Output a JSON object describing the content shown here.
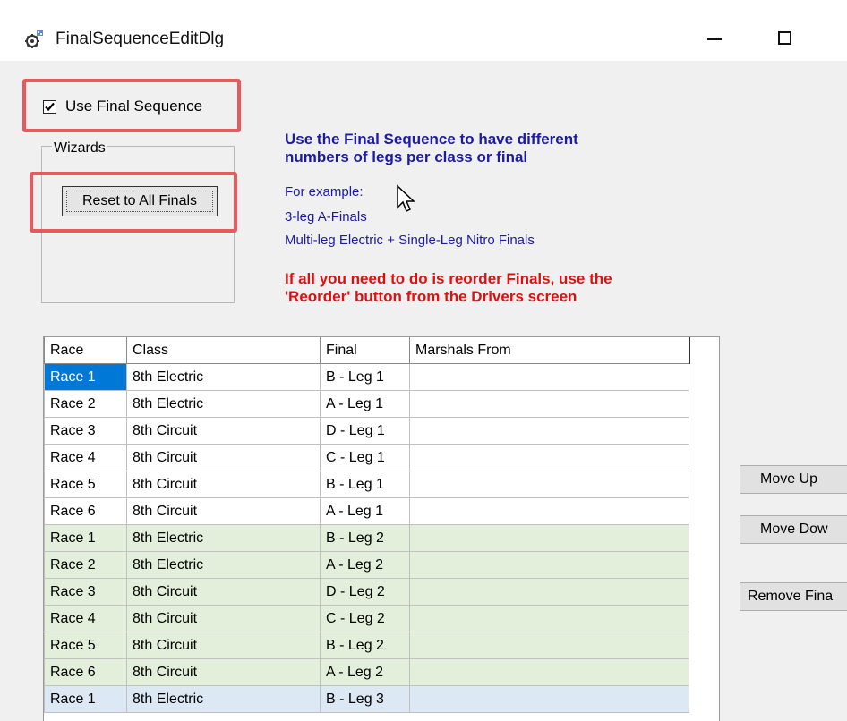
{
  "window": {
    "title": "FinalSequenceEditDlg"
  },
  "use_final_sequence": {
    "label": "Use Final Sequence",
    "checked": true
  },
  "wizards": {
    "legend": "Wizards",
    "reset_label": "Reset to All Finals"
  },
  "info": {
    "heading_line1": "Use the Final Sequence to have different",
    "heading_line2": "numbers of legs per class or final",
    "example_intro": "For example:",
    "example_1": "3-leg A-Finals",
    "example_2": "Multi-leg Electric + Single-Leg Nitro Finals",
    "warning_line1": "If all you need to do is reorder Finals, use the",
    "warning_line2": "'Reorder' button from the Drivers screen"
  },
  "grid": {
    "columns": [
      "Race",
      "Class",
      "Final",
      "Marshals From"
    ],
    "rows": [
      {
        "race": "Race 1",
        "class": "8th Electric",
        "final": "B - Leg 1",
        "marshals": ""
      },
      {
        "race": "Race 2",
        "class": "8th Electric",
        "final": "A - Leg 1",
        "marshals": ""
      },
      {
        "race": "Race 3",
        "class": "8th Circuit",
        "final": "D - Leg 1",
        "marshals": ""
      },
      {
        "race": "Race 4",
        "class": "8th Circuit",
        "final": "C - Leg 1",
        "marshals": ""
      },
      {
        "race": "Race 5",
        "class": "8th Circuit",
        "final": "B - Leg 1",
        "marshals": ""
      },
      {
        "race": "Race 6",
        "class": "8th Circuit",
        "final": "A - Leg 1",
        "marshals": ""
      },
      {
        "race": "Race 1",
        "class": "8th Electric",
        "final": "B - Leg 2",
        "marshals": ""
      },
      {
        "race": "Race 2",
        "class": "8th Electric",
        "final": "A - Leg 2",
        "marshals": ""
      },
      {
        "race": "Race 3",
        "class": "8th Circuit",
        "final": "D - Leg 2",
        "marshals": ""
      },
      {
        "race": "Race 4",
        "class": "8th Circuit",
        "final": "C - Leg 2",
        "marshals": ""
      },
      {
        "race": "Race 5",
        "class": "8th Circuit",
        "final": "B - Leg 2",
        "marshals": ""
      },
      {
        "race": "Race 6",
        "class": "8th Circuit",
        "final": "A - Leg 2",
        "marshals": ""
      },
      {
        "race": "Race 1",
        "class": "8th Electric",
        "final": "B - Leg 3",
        "marshals": ""
      }
    ],
    "leg_colors": [
      "#ffffff",
      "#e3efda",
      "#dce9f5"
    ]
  },
  "buttons": {
    "move_up": "Move Up",
    "move_down": "Move Dow",
    "remove_final": "Remove Fina"
  },
  "colors": {
    "highlight": "#e8585e",
    "info_blue": "#1b1ba6",
    "warn_red": "#e01010",
    "selection": "#0078d7"
  }
}
